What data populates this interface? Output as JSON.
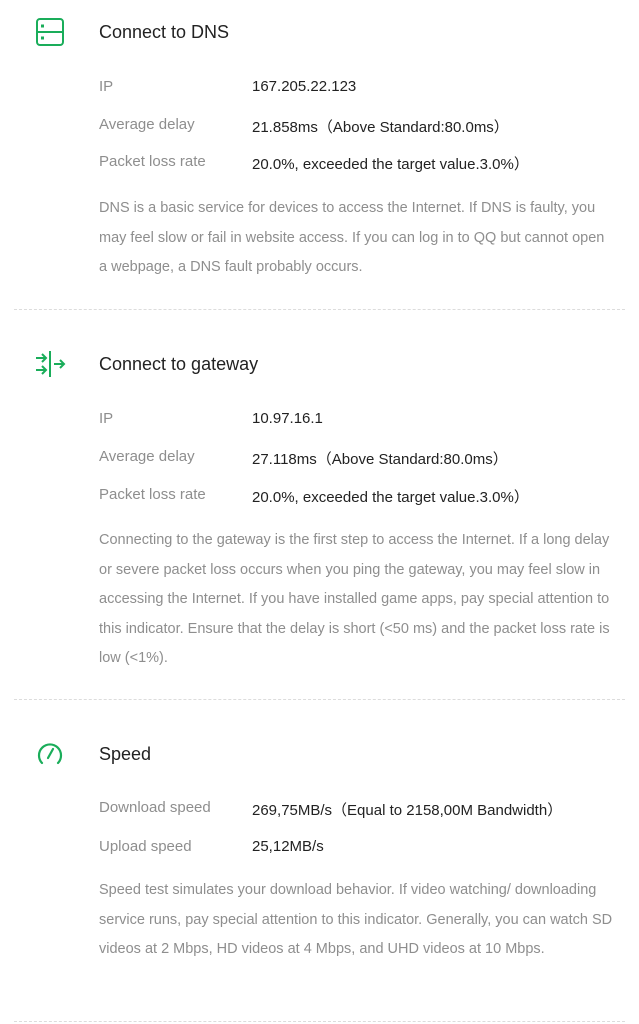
{
  "colors": {
    "accent": "#1aad5a",
    "text": "#222222",
    "muted": "#8e8e8e"
  },
  "dns": {
    "icon": "server-icon",
    "title": "Connect to DNS",
    "ip_label": "IP",
    "ip_value": "167.205.22.123",
    "delay_label": "Average delay",
    "delay_value": "21.858ms（Above Standard:80.0ms）",
    "loss_label": "Packet loss rate",
    "loss_value": "20.0%, exceeded the target value.3.0%）",
    "description": "DNS is a basic service for devices to access the Internet. If DNS is faulty, you may feel slow or fail in website access. If you can log in to QQ but cannot open a webpage, a DNS fault probably occurs."
  },
  "gateway": {
    "icon": "gateway-arrows-icon",
    "title": "Connect to gateway",
    "ip_label": "IP",
    "ip_value": "10.97.16.1",
    "delay_label": "Average delay",
    "delay_value": "27.118ms（Above Standard:80.0ms）",
    "loss_label": "Packet loss rate",
    "loss_value": "20.0%, exceeded the target value.3.0%）",
    "description": "Connecting to the gateway is the first step to access the Internet. If a long delay or severe packet loss occurs when you ping the gateway, you may feel slow in accessing the Internet. If you have installed game apps, pay special attention to this indicator. Ensure that the delay is short (<50 ms) and the packet loss rate is low (<1%)."
  },
  "speed": {
    "icon": "speedometer-icon",
    "title": "Speed",
    "download_label": "Download speed",
    "download_value": "269,75MB/s（Equal to 2158,00M Bandwidth）",
    "upload_label": "Upload speed",
    "upload_value": "25,12MB/s",
    "description": "Speed test simulates your download behavior. If video watching/ downloading service runs, pay special attention to this indicator. Generally, you can watch SD videos at 2 Mbps, HD videos at 4 Mbps, and UHD videos at 10 Mbps."
  }
}
